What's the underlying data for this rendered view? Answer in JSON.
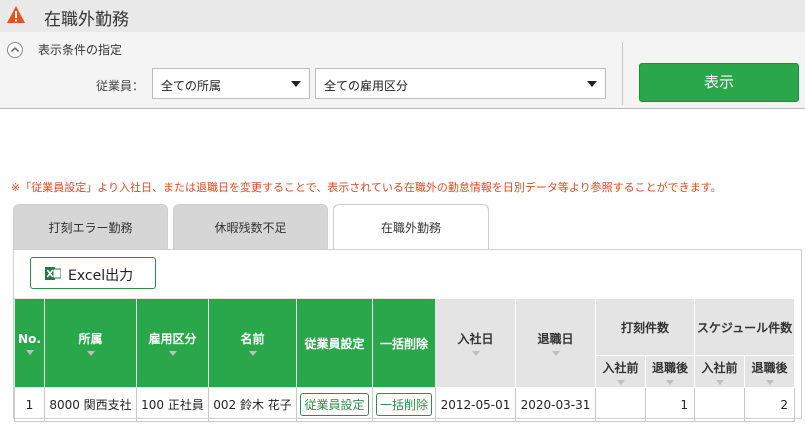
{
  "page": {
    "title": "在職外勤務"
  },
  "conditions": {
    "section_label": "表示条件の指定",
    "employee_label": "従業員：",
    "department_select": "全ての所属",
    "employment_select": "全ての雇用区分",
    "show_button": "表示"
  },
  "notice": "※「従業員設定」より入社日、または退職日を変更することで、表示されている在職外の勤怠情報を日別データ等より参照することができます。",
  "tabs": [
    {
      "label": "打刻エラー勤務",
      "active": false
    },
    {
      "label": "休暇残数不足",
      "active": false
    },
    {
      "label": "在職外勤務",
      "active": true
    }
  ],
  "excel_button": "Excel出力",
  "table": {
    "headers": {
      "no": "No.",
      "department": "所属",
      "employment": "雇用区分",
      "name": "名前",
      "emp_settings": "従業員設定",
      "bulk_delete": "一括削除",
      "hire_date": "入社日",
      "retire_date": "退職日",
      "punch_count": "打刻件数",
      "schedule_count": "スケジュール件数",
      "before_hire": "入社前",
      "after_retire": "退職後"
    },
    "rows": [
      {
        "no": "1",
        "department": "8000 関西支社",
        "employment": "100 正社員",
        "name": "002 鈴木 花子",
        "emp_settings": "従業員設定",
        "bulk_delete": "一括削除",
        "hire_date": "2012-05-01",
        "retire_date": "2020-03-31",
        "punch_before": "",
        "punch_after": "1",
        "sched_before": "",
        "sched_after": "2"
      }
    ]
  },
  "colors": {
    "accent_green": "#2aa64b",
    "warning_orange": "#e8531e",
    "notice_red": "#e34a1e"
  }
}
